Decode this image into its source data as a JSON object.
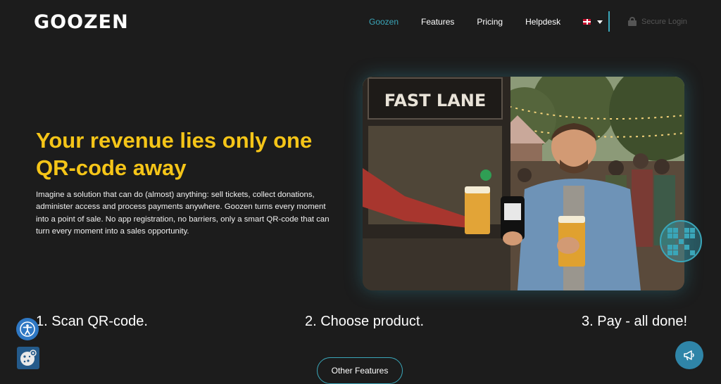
{
  "brand": {
    "logo_text": "GOOZEN"
  },
  "nav": {
    "items": [
      {
        "label": "Goozen",
        "active": true
      },
      {
        "label": "Features",
        "active": false
      },
      {
        "label": "Pricing",
        "active": false
      },
      {
        "label": "Helpdesk",
        "active": false
      }
    ],
    "language_flag": "uk-flag-icon",
    "secure_login": "Secure Login"
  },
  "hero": {
    "title": "Your revenue lies only one QR-code away",
    "description": "Imagine a solution that can do (almost) anything: sell tickets, collect donations, administer access and process payments anywhere. Goozen turns every moment into a point of sale. No app registration, no barriers, only a smart QR-code that can turn every moment into a sales opportunity.",
    "image_sign": "FAST LANE"
  },
  "steps": [
    {
      "label": "1. Scan QR-code."
    },
    {
      "label": "2. Choose product."
    },
    {
      "label": "3. Pay - all done!"
    }
  ],
  "cta": {
    "other_features": "Other Features"
  },
  "colors": {
    "accent": "#3aa6b9",
    "headline": "#f5c518",
    "background": "#1c1c1c"
  },
  "icons": [
    "lock-icon",
    "qr-code-icon",
    "accessibility-icon",
    "cookie-icon",
    "megaphone-icon",
    "chevron-down-icon"
  ]
}
